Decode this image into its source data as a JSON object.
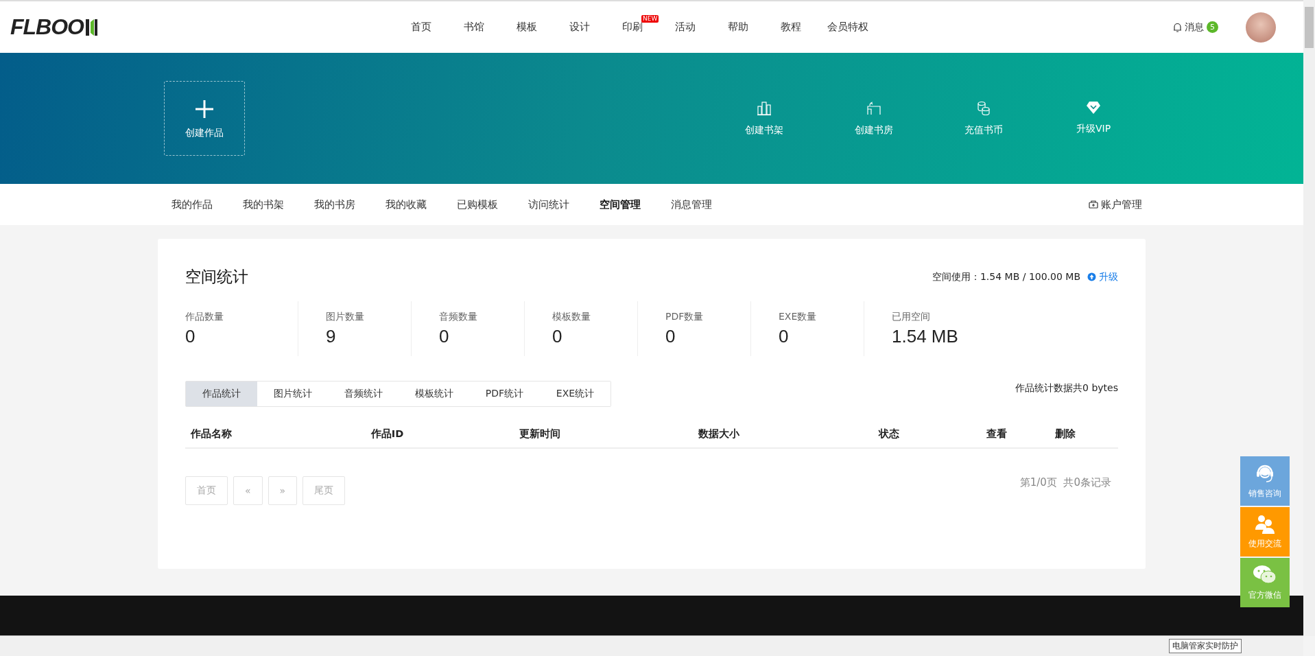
{
  "header": {
    "logo": "FLBOO",
    "nav": [
      {
        "label": "首页"
      },
      {
        "label": "书馆"
      },
      {
        "label": "模板"
      },
      {
        "label": "设计"
      },
      {
        "label": "印刷",
        "badge": "NEW"
      },
      {
        "label": "活动"
      },
      {
        "label": "帮助"
      },
      {
        "label": "教程"
      },
      {
        "label": "会员特权"
      }
    ],
    "messages": {
      "label": "消息",
      "count": "5"
    }
  },
  "banner": {
    "create": "创建作品",
    "actions": [
      {
        "kind": "shelf",
        "label": "创建书架"
      },
      {
        "kind": "study",
        "label": "创建书房"
      },
      {
        "kind": "coins",
        "label": "充值书币"
      },
      {
        "kind": "vip",
        "label": "升级VIP"
      }
    ]
  },
  "subnav": {
    "tabs": [
      {
        "label": "我的作品",
        "selected": false
      },
      {
        "label": "我的书架",
        "selected": false
      },
      {
        "label": "我的书房",
        "selected": false
      },
      {
        "label": "我的收藏",
        "selected": false
      },
      {
        "label": "已购模板",
        "selected": false
      },
      {
        "label": "访问统计",
        "selected": false
      },
      {
        "label": "空间管理",
        "selected": true
      },
      {
        "label": "消息管理",
        "selected": false
      }
    ],
    "account": "账户管理"
  },
  "card": {
    "title": "空间统计",
    "usage": "空间使用：1.54 MB / 100.00 MB",
    "upgrade": "升级",
    "stats": [
      {
        "label": "作品数量",
        "value": "0"
      },
      {
        "label": "图片数量",
        "value": "9"
      },
      {
        "label": "音频数量",
        "value": "0"
      },
      {
        "label": "模板数量",
        "value": "0"
      },
      {
        "label": "PDF数量",
        "value": "0"
      },
      {
        "label": "EXE数量",
        "value": "0"
      },
      {
        "label": "已用空间",
        "value": "1.54 MB"
      }
    ],
    "tabs": [
      {
        "label": "作品统计",
        "selected": true
      },
      {
        "label": "图片统计",
        "selected": false
      },
      {
        "label": "音频统计",
        "selected": false
      },
      {
        "label": "模板统计",
        "selected": false
      },
      {
        "label": "PDF统计",
        "selected": false
      },
      {
        "label": "EXE统计",
        "selected": false
      }
    ],
    "summary": "作品统计数据共0 bytes",
    "table": {
      "columns": [
        "作品名称",
        "作品ID",
        "更新时间",
        "数据大小",
        "状态",
        "查看",
        "删除"
      ]
    },
    "pagination": {
      "buttons": [
        {
          "label": "首页",
          "disabled": true
        },
        {
          "label": "«",
          "disabled": true
        },
        {
          "label": "»",
          "disabled": true
        },
        {
          "label": "尾页",
          "disabled": true
        }
      ],
      "info": "第1/0页  共0条记录"
    }
  },
  "float_buttons": [
    {
      "kind": "headset",
      "label": "销售咨询",
      "color": "#6ca6dc"
    },
    {
      "kind": "people",
      "label": "使用交流",
      "color": "#ff9900"
    },
    {
      "kind": "chat",
      "label": "官方微信",
      "color": "#7ac143"
    }
  ],
  "taskbar": {
    "tooltip": "电脑管家实时防护"
  }
}
